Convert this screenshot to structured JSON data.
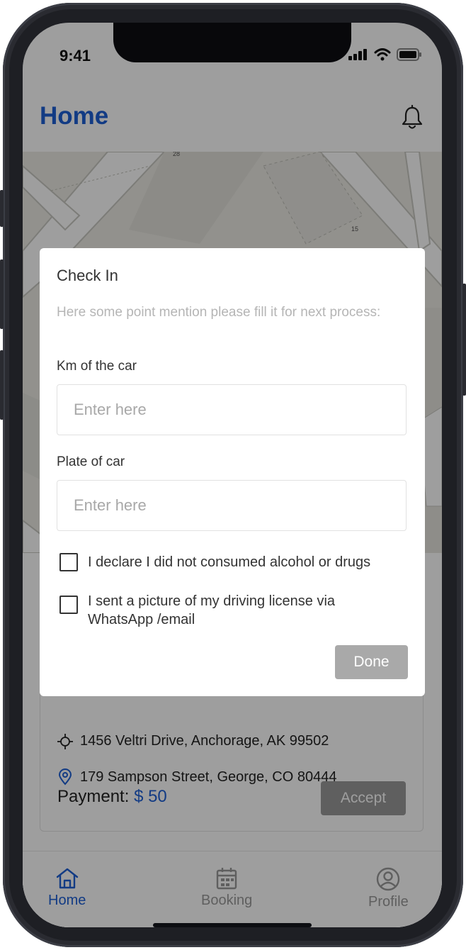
{
  "status": {
    "time": "9:41"
  },
  "header": {
    "title": "Home"
  },
  "trip": {
    "pickup": "1456 Veltri Drive, Anchorage, AK 99502",
    "dropoff": "179 Sampson Street, George, CO 80444",
    "payment_label": "Payment:",
    "payment_amount": "$ 50",
    "accept_label": "Accept"
  },
  "tabs": [
    {
      "label": "Home",
      "icon": "home-icon",
      "active": true
    },
    {
      "label": "Booking",
      "icon": "calendar-icon",
      "active": false
    },
    {
      "label": "Profile",
      "icon": "user-icon",
      "active": false
    }
  ],
  "modal": {
    "title": "Check In",
    "subtitle": "Here some point mention please fill it for next process:",
    "km_label": "Km of the car",
    "km_placeholder": "Enter here",
    "plate_label": "Plate of car",
    "plate_placeholder": "Enter here",
    "check1": "I declare I did not consumed alcohol or drugs",
    "check2": "I sent a picture of my driving license via WhatsApp /email",
    "done_label": "Done"
  },
  "map": {
    "labels": [
      "28",
      "15"
    ]
  },
  "colors": {
    "accent": "#1e5fd6",
    "disabled_button": "#a9a9a9",
    "overlay": "rgba(0,0,0,0.38)"
  }
}
